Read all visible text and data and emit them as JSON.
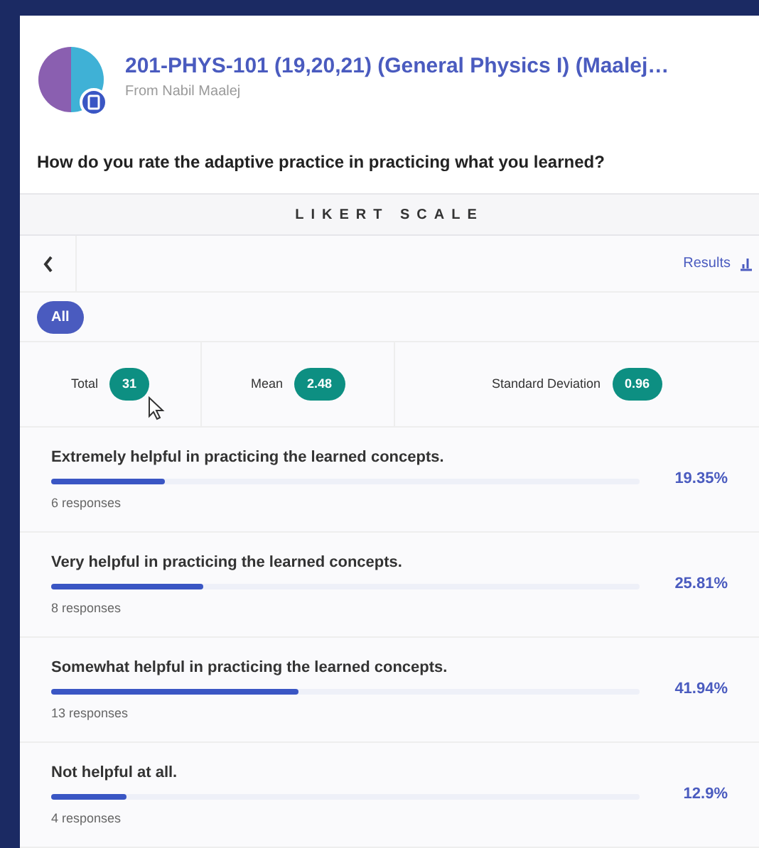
{
  "header": {
    "title": "201-PHYS-101 (19,20,21) (General Physics I) (Maalej…",
    "subtitle": "From Nabil Maalej"
  },
  "question": "How do you rate the adaptive practice in practicing what you learned?",
  "section_title": "LIKERT SCALE",
  "nav": {
    "results_link": "Results"
  },
  "filters": [
    {
      "label": "All",
      "selected": true
    }
  ],
  "stats": [
    {
      "label": "Total",
      "value": "31"
    },
    {
      "label": "Mean",
      "value": "2.48"
    },
    {
      "label": "Standard Deviation",
      "value": "0.96"
    }
  ],
  "options": [
    {
      "label": "Extremely helpful in practicing the learned concepts.",
      "responses": "6 responses",
      "percent": "19.35%",
      "level": 0.1935
    },
    {
      "label": "Very helpful in practicing the learned concepts.",
      "responses": "8 responses",
      "percent": "25.81%",
      "level": 0.2581
    },
    {
      "label": "Somewhat helpful in practicing the learned concepts.",
      "responses": "13 responses",
      "percent": "41.94%",
      "level": 0.4194
    },
    {
      "label": "Not helpful at all.",
      "responses": "4 responses",
      "percent": "12.9%",
      "level": 0.129
    }
  ]
}
